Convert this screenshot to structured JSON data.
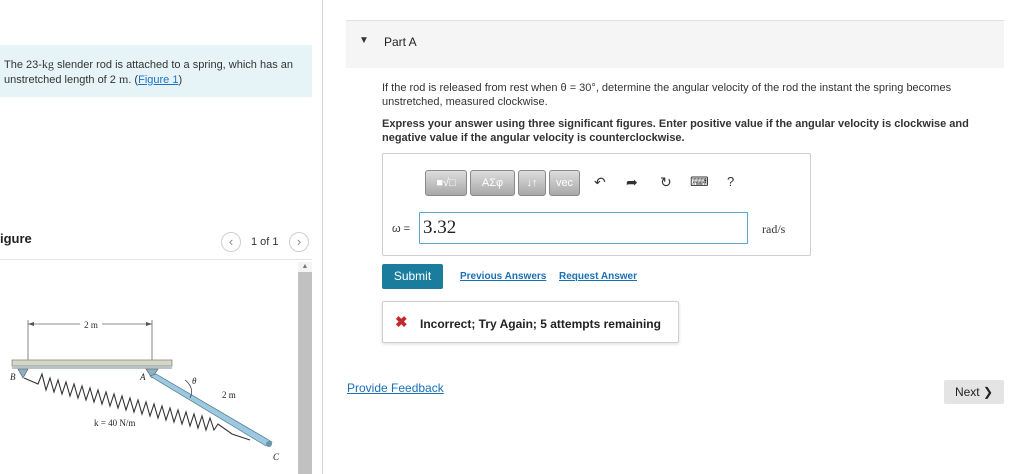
{
  "problem": {
    "text_before": "The 23-",
    "mass_unit": "kg",
    "text_middle": " slender rod is attached to a spring, which has an unstretched length of 2 ",
    "length_unit": "m",
    "text_after": ". (",
    "figure_link": "Figure 1",
    "text_close": ")"
  },
  "figure_panel": {
    "title": "igure",
    "counter": "1 of 1",
    "prev_icon": "chevron-left-icon",
    "next_icon": "chevron-right-icon",
    "labels": {
      "dim_top": "2 m",
      "point_b": "B",
      "point_a": "A",
      "angle": "θ",
      "dim_rod": "2 m",
      "spring_const": "k = 40 N/m",
      "point_c": "C"
    }
  },
  "part": {
    "caret_icon": "caret-down-icon",
    "title": "Part A"
  },
  "question": "If the rod is released from rest when θ = 30°, determine the angular velocity of the rod the instant the spring becomes unstretched, measured clockwise.",
  "instructions": "Express your answer using three significant figures. Enter positive value if the angular velocity is clockwise and negative value if the angular velocity is counterclockwise.",
  "toolbar": {
    "templates_label": "■√□",
    "greek_label": "ΑΣφ",
    "arrows_label": "↓↑",
    "vec_label": "vec",
    "undo_icon": "undo-icon",
    "redo_icon": "redo-icon",
    "reset_icon": "reset-icon",
    "keyboard_icon": "keyboard-icon",
    "help_label": "?"
  },
  "answer": {
    "variable": "ω =",
    "value": "3.32",
    "unit": "rad/s"
  },
  "actions": {
    "submit": "Submit",
    "previous_answers": "Previous Answers",
    "request_answer": "Request Answer"
  },
  "feedback": {
    "icon": "close-x-icon",
    "message": "Incorrect; Try Again; 5 attempts remaining"
  },
  "footer": {
    "provide_feedback": "Provide Feedback",
    "next": "Next"
  },
  "colors": {
    "problem_bg": "#e6f4f7",
    "submit_bg": "#1a7d9e",
    "link": "#1a6fb5",
    "error": "#c62828",
    "input_border": "#5aa7c9"
  }
}
